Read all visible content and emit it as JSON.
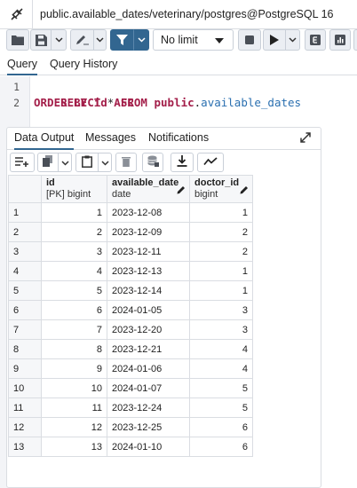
{
  "window": {
    "title": "public.available_dates/veterinary/postgres@PostgreSQL 16"
  },
  "toolbar": {
    "limit_value": "No limit"
  },
  "editor": {
    "tabs": [
      "Query",
      "Query History"
    ],
    "active_tab": "Query",
    "lines": [
      {
        "no": "1",
        "kw1": "SELECT",
        "mid": " * ",
        "kw2": "FROM",
        "schema": " public",
        "dot": ".",
        "table": "available_dates"
      },
      {
        "no": "2",
        "text": "ORDER BY id ASC"
      }
    ]
  },
  "output": {
    "tabs": [
      "Data Output",
      "Messages",
      "Notifications"
    ],
    "active_tab": "Data Output",
    "columns": [
      {
        "name": "id",
        "type": "[PK] bigint"
      },
      {
        "name": "available_date",
        "type": "date"
      },
      {
        "name": "doctor_id",
        "type": "bigint"
      }
    ],
    "rows": [
      {
        "n": "1",
        "id": "1",
        "date": "2023-12-08",
        "doctor": "1"
      },
      {
        "n": "2",
        "id": "2",
        "date": "2023-12-09",
        "doctor": "2"
      },
      {
        "n": "3",
        "id": "3",
        "date": "2023-12-11",
        "doctor": "2"
      },
      {
        "n": "4",
        "id": "4",
        "date": "2023-12-13",
        "doctor": "1"
      },
      {
        "n": "5",
        "id": "5",
        "date": "2023-12-14",
        "doctor": "1"
      },
      {
        "n": "6",
        "id": "6",
        "date": "2024-01-05",
        "doctor": "3"
      },
      {
        "n": "7",
        "id": "7",
        "date": "2023-12-20",
        "doctor": "3"
      },
      {
        "n": "8",
        "id": "8",
        "date": "2023-12-21",
        "doctor": "4"
      },
      {
        "n": "9",
        "id": "9",
        "date": "2024-01-06",
        "doctor": "4"
      },
      {
        "n": "10",
        "id": "10",
        "date": "2024-01-07",
        "doctor": "5"
      },
      {
        "n": "11",
        "id": "11",
        "date": "2023-12-24",
        "doctor": "5"
      },
      {
        "n": "12",
        "id": "12",
        "date": "2023-12-25",
        "doctor": "6"
      },
      {
        "n": "13",
        "id": "13",
        "date": "2024-01-10",
        "doctor": "6"
      }
    ]
  },
  "colors": {
    "primary": "#326690",
    "keyword": "#a31e49",
    "identifier": "#2a6fb0"
  },
  "icons": [
    "connection-icon",
    "folder-icon",
    "save-icon",
    "pencil-icon",
    "filter-icon",
    "stop-icon",
    "play-icon",
    "explain-icon",
    "explain-analyze-icon",
    "expand-icon",
    "add-row-icon",
    "copy-icon",
    "paste-icon",
    "delete-icon",
    "save-data-icon",
    "download-icon",
    "graph-icon"
  ]
}
